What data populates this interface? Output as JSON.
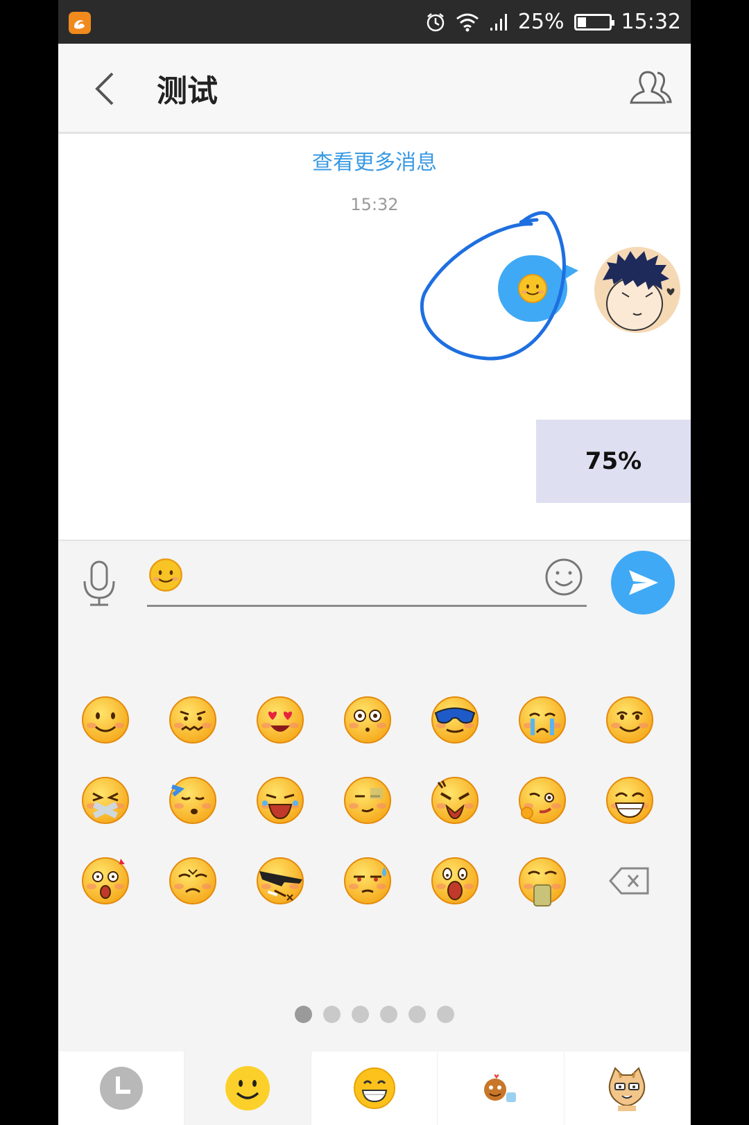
{
  "status_bar": {
    "battery": "25%",
    "battery_level": 0.25,
    "time": "15:32",
    "icons": [
      "uc-browser-icon",
      "alarm-icon",
      "wifi-icon",
      "signal-icon",
      "battery-icon"
    ]
  },
  "header": {
    "title": "测试",
    "back_icon": "chevron-left-icon",
    "members_icon": "group-icon"
  },
  "chat": {
    "load_more": "查看更多消息",
    "timestamp": "15:32",
    "messages": [
      {
        "from": "me",
        "content": "smile-emoji"
      }
    ],
    "progress": "75%"
  },
  "input": {
    "value_emoji": "smile-emoji",
    "mic_icon": "microphone-icon",
    "emoji_icon": "smiley-outline-icon",
    "send_icon": "paper-plane-icon"
  },
  "emoji_panel": {
    "rows": [
      [
        "smile",
        "worried",
        "heart-eyes",
        "surprised",
        "cool-sunglasses",
        "crying",
        "shy-grin"
      ],
      [
        "shut-mouth",
        "sleepy",
        "bawling",
        "sweat-squint",
        "angry",
        "thinking-wink",
        "big-grin"
      ],
      [
        "shocked",
        "upset",
        "hehe-sunglasses",
        "cold-sweat",
        "scream",
        "vomit",
        "delete-key"
      ]
    ],
    "pages": 6,
    "active_page": 1,
    "tabs": [
      "recent",
      "classic",
      "emoji",
      "animated",
      "cat"
    ],
    "active_tab": 1
  },
  "colors": {
    "accent": "#3fa9f5",
    "link": "#3a9ae3",
    "status_bar": "#2b2b2b",
    "annotation": "#1e6fe0",
    "progress_bg": "#dedff0"
  }
}
